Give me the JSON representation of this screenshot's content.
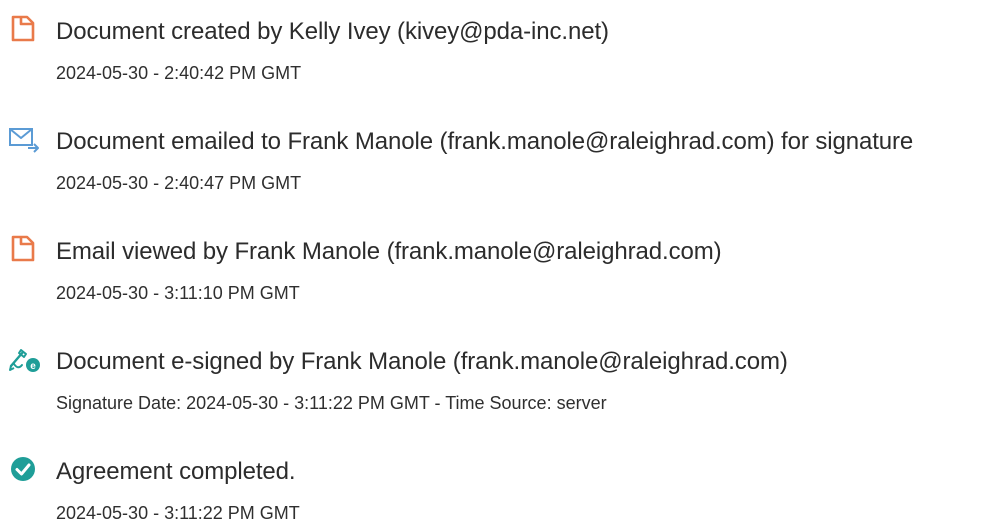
{
  "colors": {
    "doc_icon": "#e97a4a",
    "mail_icon": "#5b9bd5",
    "signed_icon": "#1f9e98",
    "completed_icon": "#1f9e98",
    "text": "#2c2c2c"
  },
  "events": [
    {
      "icon": "document-icon",
      "title": "Document created by Kelly Ivey (kivey@pda-inc.net)",
      "detail": "2024-05-30 - 2:40:42 PM GMT"
    },
    {
      "icon": "email-sent-icon",
      "title": "Document emailed to Frank Manole (frank.manole@raleighrad.com) for signature",
      "detail": "2024-05-30 - 2:40:47 PM GMT"
    },
    {
      "icon": "document-icon",
      "title": "Email viewed by Frank Manole (frank.manole@raleighrad.com)",
      "detail": "2024-05-30 - 3:11:10 PM GMT"
    },
    {
      "icon": "e-sign-icon",
      "title": "Document e-signed by Frank Manole (frank.manole@raleighrad.com)",
      "detail": "Signature Date: 2024-05-30 - 3:11:22 PM GMT - Time Source: server"
    },
    {
      "icon": "checkmark-circle-icon",
      "title": "Agreement completed.",
      "detail": "2024-05-30 - 3:11:22 PM GMT"
    }
  ]
}
